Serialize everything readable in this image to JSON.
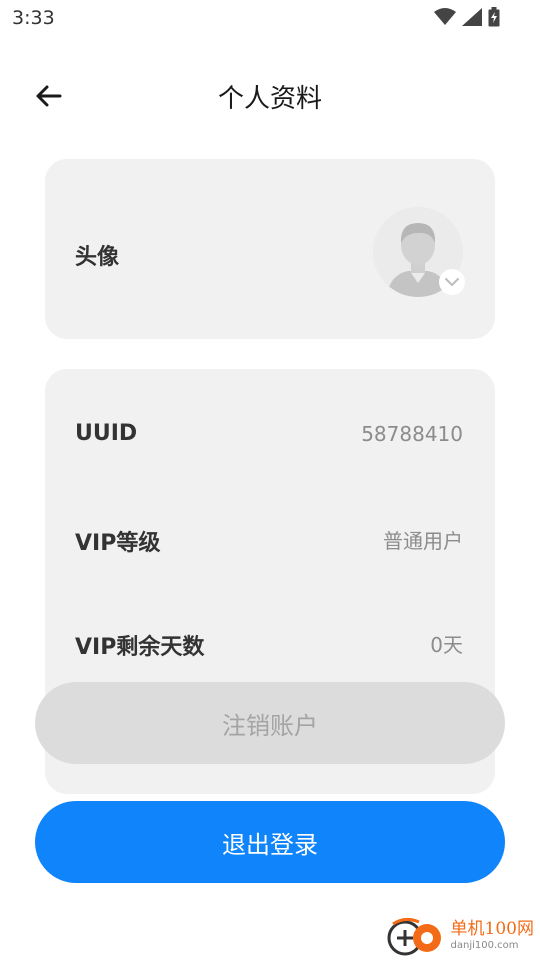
{
  "status_bar": {
    "time": "3:33"
  },
  "header": {
    "title": "个人资料"
  },
  "avatar_card": {
    "label": "头像"
  },
  "info_rows": [
    {
      "label": "UUID",
      "value": "58788410"
    },
    {
      "label": "VIP等级",
      "value": "普通用户"
    },
    {
      "label": "VIP剩余天数",
      "value": "0天"
    }
  ],
  "buttons": {
    "deactivate_label": "注销账户",
    "logout_label": "退出登录"
  },
  "watermark": {
    "name": "单机100网",
    "url": "danji100.com"
  },
  "colors": {
    "primary": "#1084fb",
    "card_bg": "#f1f1f1",
    "disabled_button": "#dcdcdc",
    "watermark_orange": "#f36b16"
  },
  "icons": [
    "back-arrow-icon",
    "wifi-icon",
    "signal-icon",
    "battery-charging-icon",
    "avatar-placeholder-icon",
    "chevron-down-icon"
  ]
}
